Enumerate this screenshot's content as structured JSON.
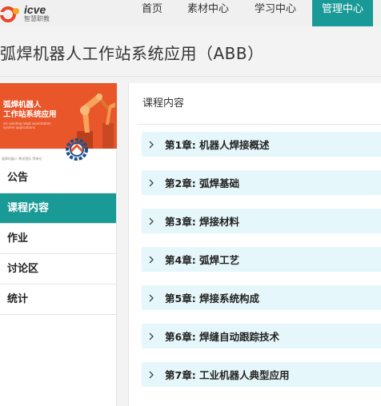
{
  "nav": {
    "logo_en": "icve",
    "logo_cn": "智慧职教",
    "items": [
      {
        "label": "首页"
      },
      {
        "label": "素材中心"
      },
      {
        "label": "学习中心"
      },
      {
        "label": "管理中心"
      }
    ]
  },
  "course": {
    "title": "弧焊机器人工作站系统应用（ABB）"
  },
  "banner": {
    "title_line1": "弧焊机器人",
    "title_line2": "工作站系统应用",
    "subtitle_en": "arc welding robot workstation system applications",
    "footer_text": "弧焊机器人 教学团队 等单位"
  },
  "sidebar": {
    "items": [
      {
        "label": "公告",
        "active": false
      },
      {
        "label": "课程内容",
        "active": true
      },
      {
        "label": "作业",
        "active": false
      },
      {
        "label": "讨论区",
        "active": false
      },
      {
        "label": "统计",
        "active": false
      }
    ]
  },
  "content": {
    "heading": "课程内容",
    "chapters": [
      {
        "label": "第1章: 机器人焊接概述"
      },
      {
        "label": "第2章: 弧焊基础"
      },
      {
        "label": "第3章: 焊接材料"
      },
      {
        "label": "第4章: 弧焊工艺"
      },
      {
        "label": "第5章: 焊接系统构成"
      },
      {
        "label": "第6章: 焊缝自动跟踪技术"
      },
      {
        "label": "第7章: 工业机器人典型应用"
      }
    ]
  },
  "colors": {
    "accent": "#1a9a96",
    "chapter_bg": "#e6f7fb",
    "banner": "#e8562a"
  }
}
